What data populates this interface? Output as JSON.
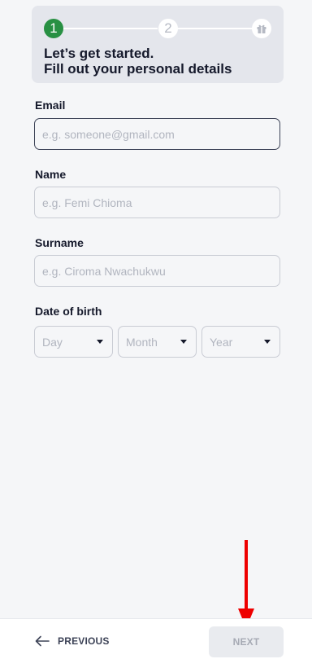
{
  "stepper": {
    "steps": [
      {
        "number": "1",
        "state": "active",
        "color": "#289043"
      },
      {
        "number": "2",
        "state": "upcoming"
      },
      {
        "icon": "gift-icon",
        "state": "upcoming"
      }
    ],
    "title_line1": "Let’s get started.",
    "title_line2": "Fill out your personal details"
  },
  "form": {
    "email": {
      "label": "Email",
      "placeholder": "e.g. someone@gmail.com",
      "value": ""
    },
    "name": {
      "label": "Name",
      "placeholder": "e.g. Femi Chioma",
      "value": ""
    },
    "surname": {
      "label": "Surname",
      "placeholder": "e.g. Ciroma Nwachukwu",
      "value": ""
    },
    "dob": {
      "label": "Date of birth",
      "day": "Day",
      "month": "Month",
      "year": "Year"
    }
  },
  "footer": {
    "previous_label": "PREVIOUS",
    "next_label": "NEXT",
    "next_disabled": true
  },
  "annotation": {
    "icon": "red-down-arrow",
    "color": "#ee0000"
  }
}
